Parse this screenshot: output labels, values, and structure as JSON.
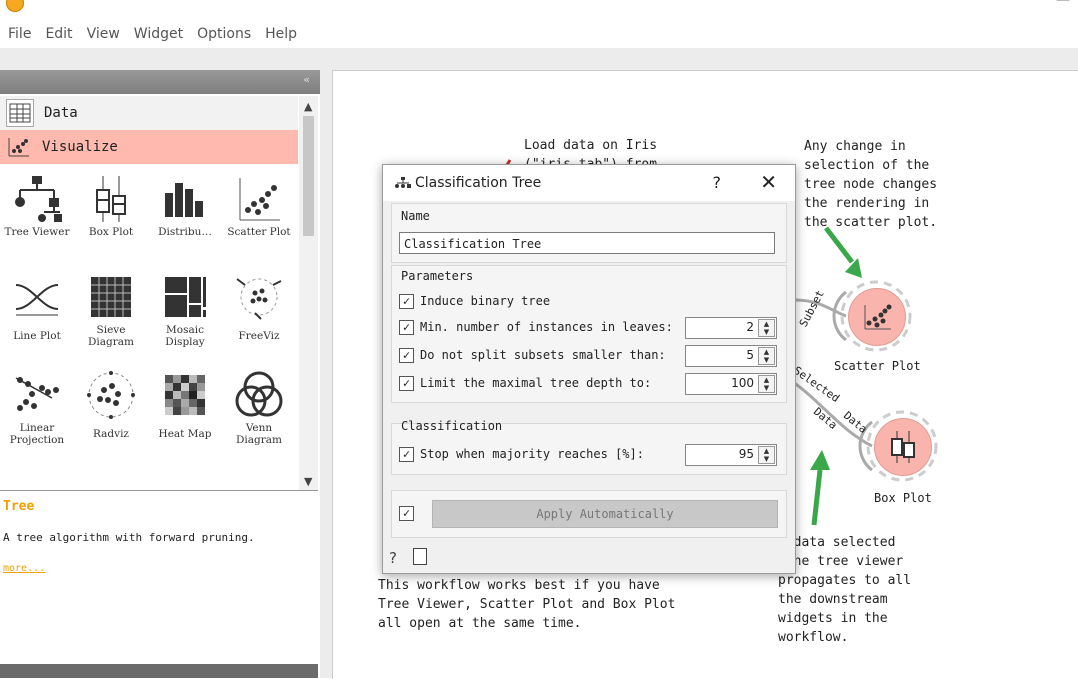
{
  "menu": [
    "File",
    "Edit",
    "View",
    "Widget",
    "Options",
    "Help"
  ],
  "dock": {
    "collapse_label": "«",
    "categories": [
      {
        "label": "Data",
        "icon": "table-icon"
      },
      {
        "label": "Visualize",
        "icon": "scatter-icon"
      }
    ],
    "widgets": [
      {
        "label": "Tree Viewer",
        "icon": "tree-viewer-icon"
      },
      {
        "label": "Box Plot",
        "icon": "box-plot-icon"
      },
      {
        "label": "Distribu…",
        "icon": "distributions-icon"
      },
      {
        "label": "Scatter Plot",
        "icon": "scatter-plot-icon"
      },
      {
        "label": "Line Plot",
        "icon": "line-plot-icon"
      },
      {
        "label": "Sieve Diagram",
        "icon": "sieve-diagram-icon"
      },
      {
        "label": "Mosaic Display",
        "icon": "mosaic-display-icon"
      },
      {
        "label": "FreeViz",
        "icon": "freeviz-icon"
      },
      {
        "label": "Linear Projection",
        "icon": "linear-projection-icon"
      },
      {
        "label": "Radviz",
        "icon": "radviz-icon"
      },
      {
        "label": "Heat Map",
        "icon": "heat-map-icon"
      },
      {
        "label": "Venn Diagram",
        "icon": "venn-diagram-icon"
      }
    ],
    "description": {
      "title": "Tree",
      "text": "A tree algorithm with forward pruning.",
      "more": "more..."
    }
  },
  "canvas": {
    "note_load": "Load data on Iris\n(\"iris.tab\") from",
    "note_change": "Any change in\nselection of the\ntree node changes\nthe rendering in\nthe scatter plot.",
    "note_selected": "e data selected\n the tree viewer\npropagates to all\nthe downstream\nwidgets in the\nworkflow.",
    "note_workflow": "This workflow works best if you have\nTree Viewer, Scatter Plot and Box Plot\nall open at the same time.",
    "nodes": [
      {
        "label": "Scatter Plot",
        "icon": "scatter-plot-icon"
      },
      {
        "label": "Box Plot",
        "icon": "box-plot-icon"
      }
    ],
    "link_labels": [
      "Subset",
      "Selected",
      "Data",
      "Data"
    ]
  },
  "dialog": {
    "title": "Classification Tree",
    "help": "?",
    "close": "✕",
    "name_group": {
      "title": "Name",
      "value": "Classification Tree"
    },
    "parameters": {
      "title": "Parameters",
      "options": [
        {
          "label": "Induce binary tree",
          "checked": true,
          "value": null
        },
        {
          "label": "Min. number of instances in leaves:",
          "checked": true,
          "value": "2"
        },
        {
          "label": "Do not split subsets smaller than:",
          "checked": true,
          "value": "5"
        },
        {
          "label": "Limit the maximal tree depth to:",
          "checked": true,
          "value": "100"
        }
      ]
    },
    "classification": {
      "title": "Classification",
      "option": {
        "label": "Stop when majority reaches [%]:",
        "checked": true,
        "value": "95"
      }
    },
    "apply": {
      "label": "Apply Automatically",
      "checked": true
    }
  },
  "colors": {
    "accent": "#f0a000",
    "category_highlight": "#ffb9ae",
    "node_fill": "#f9b4ad",
    "arrow": "#3aa84a"
  }
}
